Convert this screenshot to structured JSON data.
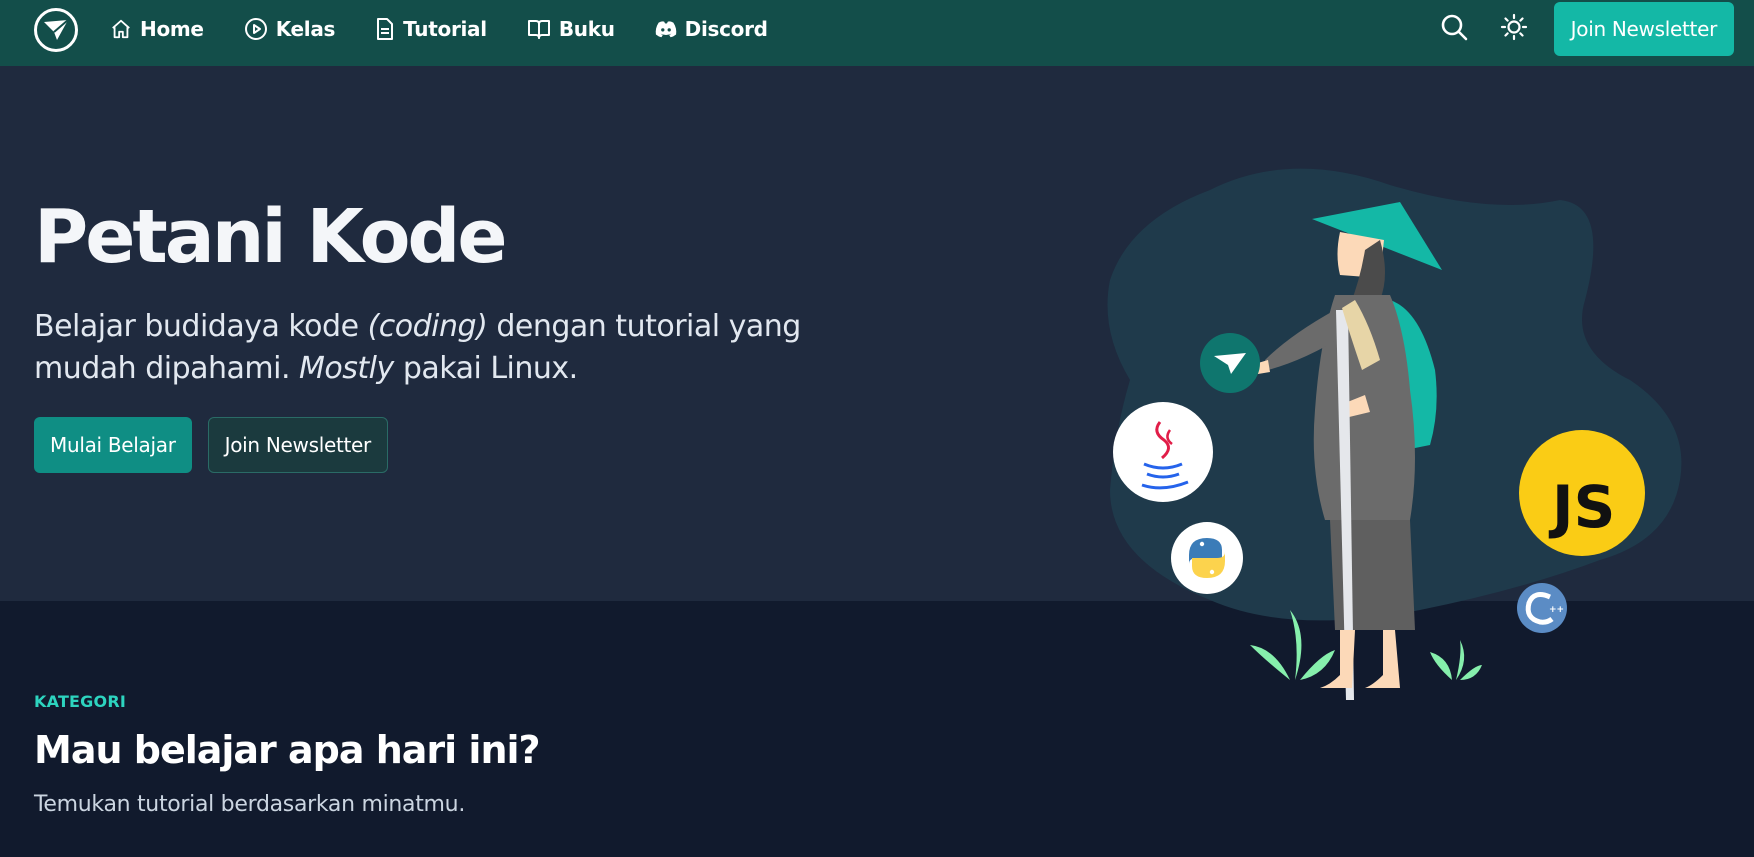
{
  "navbar": {
    "logo_icon": "petanikode-logo-icon",
    "items": [
      {
        "label": "Home",
        "icon": "home-icon"
      },
      {
        "label": "Kelas",
        "icon": "play-circle-icon"
      },
      {
        "label": "Tutorial",
        "icon": "document-icon"
      },
      {
        "label": "Buku",
        "icon": "book-open-icon"
      },
      {
        "label": "Discord",
        "icon": "discord-icon"
      }
    ],
    "search_icon": "search-icon",
    "theme_icon": "sun-icon",
    "newsletter_label": "Join Newsletter"
  },
  "hero": {
    "title": "Petani Kode",
    "subtitle_part1": "Belajar budidaya kode ",
    "subtitle_em1": "(coding)",
    "subtitle_part2": " dengan tutorial yang mudah dipahami. ",
    "subtitle_em2": "Mostly",
    "subtitle_part3": " pakai Linux.",
    "primary_button": "Mulai Belajar",
    "secondary_button": "Join Newsletter",
    "badge_js": "JS"
  },
  "kategori": {
    "label": "KATEGORI",
    "title": "Mau belajar apa hari ini?",
    "description": "Temukan tutorial berdasarkan minatmu."
  },
  "colors": {
    "navbar_bg": "#134e4a",
    "hero_bg": "#1f2a3e",
    "page_bg": "#111a2d",
    "accent": "#14b8a6",
    "accent_text": "#2dd4bf"
  }
}
